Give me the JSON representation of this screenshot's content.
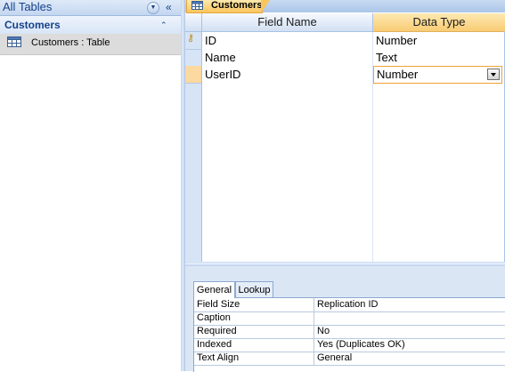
{
  "nav": {
    "title": "All Tables",
    "group": "Customers",
    "items": [
      {
        "label": "Customers : Table",
        "icon": "table-icon"
      }
    ],
    "icons": {
      "dropdown": "chevron-down-icon",
      "collapse": "double-chevron-left-icon",
      "group_collapse": "double-chevron-up-icon"
    }
  },
  "document_tab": {
    "label": "Customers",
    "icon": "table-icon"
  },
  "grid": {
    "columns": [
      "Field Name",
      "Data Type"
    ],
    "rows": [
      {
        "field_name": "ID",
        "data_type": "Number",
        "primary_key": true
      },
      {
        "field_name": "Name",
        "data_type": "Text",
        "primary_key": false
      },
      {
        "field_name": "UserID",
        "data_type": "Number",
        "primary_key": false,
        "editing": true
      }
    ]
  },
  "properties": {
    "tabs": [
      "General",
      "Lookup"
    ],
    "active_tab": "General",
    "rows": [
      {
        "label": "Field Size",
        "value": "Replication ID"
      },
      {
        "label": "Caption",
        "value": ""
      },
      {
        "label": "Required",
        "value": "No"
      },
      {
        "label": "Indexed",
        "value": "Yes (Duplicates OK)"
      },
      {
        "label": "Text Align",
        "value": "General"
      }
    ]
  },
  "colors": {
    "accent": "#f9c55d",
    "nav_header_text": "#15428b",
    "pane_background": "#dbe6f5"
  }
}
